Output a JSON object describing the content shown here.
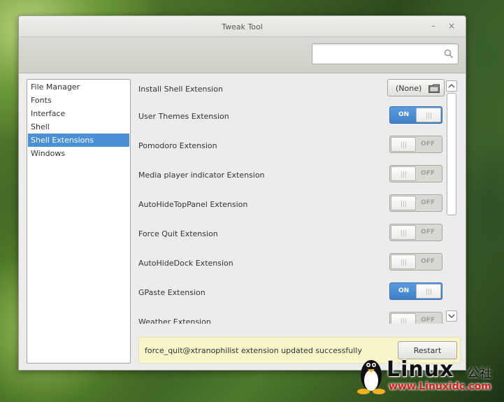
{
  "window": {
    "title": "Tweak Tool",
    "minimize_glyph": "–",
    "close_glyph": "×"
  },
  "search": {
    "placeholder": "",
    "value": ""
  },
  "sidebar": {
    "items": [
      {
        "label": "File Manager",
        "selected": false
      },
      {
        "label": "Fonts",
        "selected": false
      },
      {
        "label": "Interface",
        "selected": false
      },
      {
        "label": "Shell",
        "selected": false
      },
      {
        "label": "Shell Extensions",
        "selected": true
      },
      {
        "label": "Windows",
        "selected": false
      }
    ]
  },
  "settings": {
    "install": {
      "label": "Install Shell Extension",
      "button_label": "(None)"
    },
    "extensions": [
      {
        "label": "User Themes Extension",
        "state": "ON"
      },
      {
        "label": "Pomodoro Extension",
        "state": "OFF"
      },
      {
        "label": "Media player indicator Extension",
        "state": "OFF"
      },
      {
        "label": "AutoHideTopPanel Extension",
        "state": "OFF"
      },
      {
        "label": "Force Quit Extension",
        "state": "OFF"
      },
      {
        "label": "AutoHideDock Extension",
        "state": "OFF"
      },
      {
        "label": "GPaste Extension",
        "state": "ON"
      },
      {
        "label": "Weather Extension",
        "state": "OFF"
      }
    ]
  },
  "infobar": {
    "message": "force_quit@xtranophilist extension updated successfully",
    "button_label": "Restart"
  },
  "watermark": {
    "brand": "Linux",
    "brand_cn": "公社",
    "url": "www.Linuxidc.com"
  },
  "colors": {
    "accent": "#4a90d9",
    "switch_on": "#4a8bd4",
    "infobar_bg": "#f8f6c8",
    "watermark_url": "#d4201c"
  }
}
